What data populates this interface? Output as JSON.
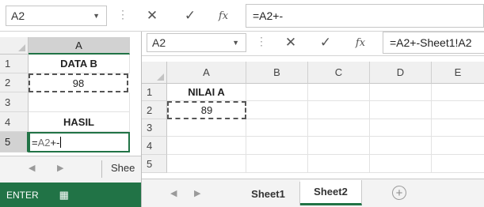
{
  "back_window": {
    "name_box": "A2",
    "formula": "=A2+-",
    "fx_label": "fx",
    "columns": [
      "A"
    ],
    "rows": [
      {
        "num": "1",
        "value": "DATA B",
        "bold": true
      },
      {
        "num": "2",
        "value": "98",
        "bold": false
      },
      {
        "num": "3",
        "value": "",
        "bold": false
      },
      {
        "num": "4",
        "value": "HASIL",
        "bold": true
      },
      {
        "num": "5",
        "value": "",
        "bold": false
      }
    ],
    "active_cell": {
      "ref": "A2",
      "op": "+-"
    },
    "sheet_tab_partial": "Shee",
    "status_mode": "ENTER"
  },
  "front_window": {
    "name_box": "A2",
    "formula": "=A2+-Sheet1!A2",
    "fx_label": "fx",
    "columns": [
      "A",
      "B",
      "C",
      "D",
      "E"
    ],
    "rows": [
      {
        "num": "1",
        "value": "NILAI A"
      },
      {
        "num": "2",
        "value": "89"
      },
      {
        "num": "3",
        "value": ""
      },
      {
        "num": "4",
        "value": ""
      },
      {
        "num": "5",
        "value": ""
      }
    ],
    "sheet_tabs": [
      {
        "label": "Sheet1",
        "active": false
      },
      {
        "label": "Sheet2",
        "active": true
      }
    ]
  },
  "colors": {
    "accent": "#217346",
    "header_bg": "#f0f0f0",
    "header_selected_bg": "#d2d2d2"
  }
}
